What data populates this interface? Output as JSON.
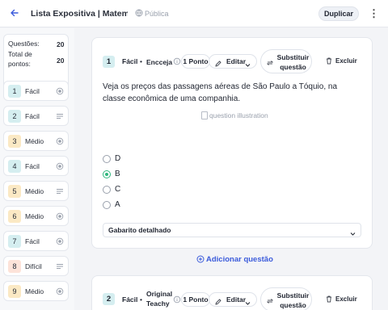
{
  "header": {
    "title": "Lista Expositiva | Matemática",
    "visibility": "Pública",
    "duplicate_label": "Duplicar",
    "accent": "#3b5bdb"
  },
  "sidebar": {
    "questions_label": "Questões:",
    "questions_value": "20",
    "points_label": "Total de pontos:",
    "points_value": "20",
    "items": [
      {
        "number": "1",
        "difficulty": "Fácil",
        "level": "easy",
        "icon": "radio-icon"
      },
      {
        "number": "2",
        "difficulty": "Fácil",
        "level": "easy",
        "icon": "lines-icon"
      },
      {
        "number": "3",
        "difficulty": "Médio",
        "level": "med",
        "icon": "radio-icon"
      },
      {
        "number": "4",
        "difficulty": "Fácil",
        "level": "easy",
        "icon": "radio-icon"
      },
      {
        "number": "5",
        "difficulty": "Médio",
        "level": "med",
        "icon": "lines-icon"
      },
      {
        "number": "6",
        "difficulty": "Médio",
        "level": "med",
        "icon": "radio-icon"
      },
      {
        "number": "7",
        "difficulty": "Fácil",
        "level": "easy",
        "icon": "radio-icon"
      },
      {
        "number": "8",
        "difficulty": "Difícil",
        "level": "hard",
        "icon": "lines-icon"
      },
      {
        "number": "9",
        "difficulty": "Médio",
        "level": "med",
        "icon": "radio-icon"
      }
    ]
  },
  "question1": {
    "number": "1",
    "difficulty": "Fácil",
    "source": "Encceja",
    "points": "1 Ponto",
    "edit_label": "Editar",
    "replace_label": "Substituir questão",
    "delete_label": "Excluir",
    "text": "Veja os preços das passagens aéreas de São Paulo a Tóquio, na classe econômica de uma companhia.",
    "image_alt": "question illustration",
    "options": [
      {
        "label": "D",
        "selected": false
      },
      {
        "label": "B",
        "selected": true
      },
      {
        "label": "C",
        "selected": false
      },
      {
        "label": "A",
        "selected": false
      }
    ],
    "answer_key_label": "Gabarito detalhado"
  },
  "add_question_label": "Adicionar questão",
  "question2": {
    "number": "2",
    "difficulty": "Fácil",
    "source": "Original Teachy",
    "points": "1 Ponto",
    "edit_label": "Editar",
    "replace_label": "Substituir questão",
    "delete_label": "Excluir"
  },
  "colors": {
    "easy": "#d5eef0",
    "medium": "#fbe9c4",
    "hard": "#fde3d9",
    "selected": "#2eb67d"
  }
}
